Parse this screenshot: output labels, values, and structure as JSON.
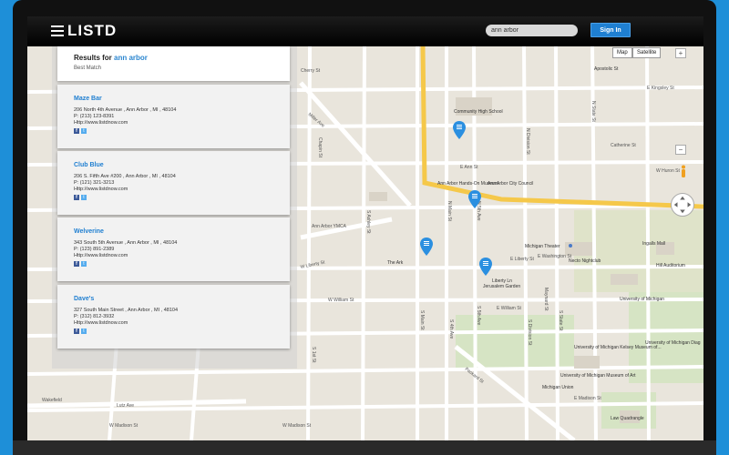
{
  "app": {
    "logo": "LISTD",
    "search_value": "ann arbor",
    "signin_label": "Sign In"
  },
  "map": {
    "map_type_labels": [
      "Map",
      "Satellite"
    ],
    "zoom_in": "+",
    "zoom_out": "−",
    "street_labels": [
      "Cherry St",
      "Miller Ave",
      "E Kingsley St",
      "N State St",
      "E Ann St",
      "Catherine St",
      "Ann Arbor YMCA",
      "W Huron St",
      "E Washington St",
      "W Liberty St",
      "E Liberty St",
      "E William St",
      "W William St",
      "S Main St",
      "S 4th Ave",
      "S 5th Ave",
      "S Division St",
      "S State St",
      "Packard St",
      "W Madison St",
      "E Madison St",
      "Lutz Ave",
      "Wakefield",
      "W Madison St",
      "Maynard St",
      "S Ashley St",
      "S 1st St",
      "Chapin St",
      "N Division St",
      "N 5th Ave",
      "N Main St"
    ],
    "poi_labels": [
      "Community High School",
      "Ann Arbor Hands-On Museum",
      "Ann Arbor City Council",
      "Michigan Theater",
      "Necto Nightclub",
      "The Ark",
      "Jerusalem Garden",
      "Ingalls Mall",
      "Hill Auditorium",
      "University of Michigan",
      "University of Michigan Kelsey Museum of...",
      "University of Michigan Diag",
      "University of Michigan Museum of Art",
      "Michigan Union",
      "Law Quadrangle",
      "Apostolic St",
      "Liberty Ln"
    ]
  },
  "results": {
    "title_prefix": "Results for ",
    "query": "ann arbor",
    "sort_label": "Best Match",
    "items": [
      {
        "name": "Maze Bar",
        "address": "206 North 4th Avenue , Ann Arbor , MI , 48104",
        "phone": "P: (213) 123-8391",
        "url": "Http://www.listdnow.com"
      },
      {
        "name": "Club Blue",
        "address": "206 S. Fifth Ave #200 , Ann Arbor , MI , 48104",
        "phone": "P: (121) 321-3213",
        "url": "Http://www.listdnow.com"
      },
      {
        "name": "Welverine",
        "address": "343 South 5th Avenue , Ann Arbor , MI , 48104",
        "phone": "P: (123) 891-2389",
        "url": "Http://www.listdnow.com"
      },
      {
        "name": "Dave's",
        "address": "327 South Main Street , Ann Arbor , MI , 48104",
        "phone": "P: (312) 812-3932",
        "url": "Http://www.listdnow.com"
      }
    ]
  },
  "colors": {
    "brand_blue": "#1f7fd1",
    "pin_blue": "#2b8fe0",
    "highway": "#f5c84a"
  }
}
